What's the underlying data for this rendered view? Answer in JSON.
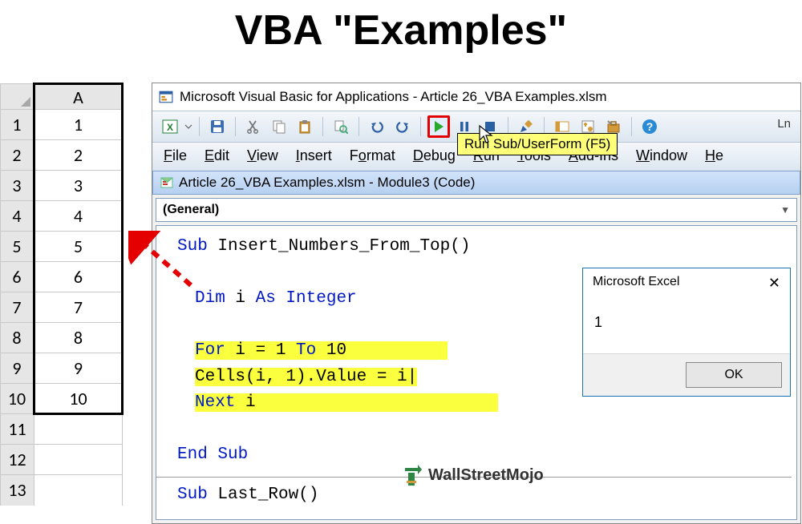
{
  "page_title": "VBA \"Examples\"",
  "sheet": {
    "col_header": "A",
    "rows": [
      "1",
      "2",
      "3",
      "4",
      "5",
      "6",
      "7",
      "8",
      "9",
      "10",
      "",
      "",
      ""
    ]
  },
  "vba": {
    "window_title": "Microsoft Visual Basic for Applications - Article 26_VBA Examples.xlsm",
    "ln_label": "Ln",
    "menus": [
      {
        "u": "F",
        "rest": "ile"
      },
      {
        "u": "E",
        "rest": "dit"
      },
      {
        "u": "V",
        "rest": "iew"
      },
      {
        "u": "I",
        "rest": "nsert"
      },
      {
        "u": "",
        "rest": "F",
        "post": "o",
        "u2": "r",
        "post2": "mat"
      },
      {
        "u": "D",
        "rest": "ebug"
      },
      {
        "u": "R",
        "rest": "un"
      },
      {
        "u": "T",
        "rest": "ools"
      },
      {
        "u": "A",
        "rest": "dd-Ins"
      },
      {
        "u": "W",
        "rest": "indow"
      },
      {
        "u": "H",
        "rest": "e"
      }
    ],
    "menu_plain": [
      "File",
      "Edit",
      "View",
      "Insert",
      "Format",
      "Debug",
      "Run",
      "Tools",
      "Add-Ins",
      "Window",
      "He"
    ],
    "menu_ul_idx": [
      0,
      0,
      0,
      0,
      -1,
      0,
      0,
      0,
      0,
      0,
      0
    ],
    "menu_ul_idx_format": 1,
    "tooltip": "Run Sub/UserForm (F5)",
    "module_title": "Article 26_VBA Examples.xlsm - Module3 (Code)",
    "dropdown_value": "(General)",
    "code": {
      "sub_decl_kw": "Sub",
      "sub_name": " Insert_Numbers_From_Top()",
      "dim_line_pre": "Dim",
      "dim_line_mid": " i ",
      "dim_line_post_kw": "As Integer",
      "for_line_pre": "For",
      "for_line_mid": " i = 1 ",
      "for_line_to": "To",
      "for_line_post": " 10",
      "cells_line": "   Cells(i, 1).Value = i",
      "next_pre": "Next",
      "next_post": " i",
      "end_sub": "End Sub",
      "sub2_kw": "Sub",
      "sub2_name": " Last_Row()"
    }
  },
  "dialog": {
    "title": "Microsoft Excel",
    "message": "1",
    "ok": "OK"
  },
  "watermark": "WallStreetMojo"
}
